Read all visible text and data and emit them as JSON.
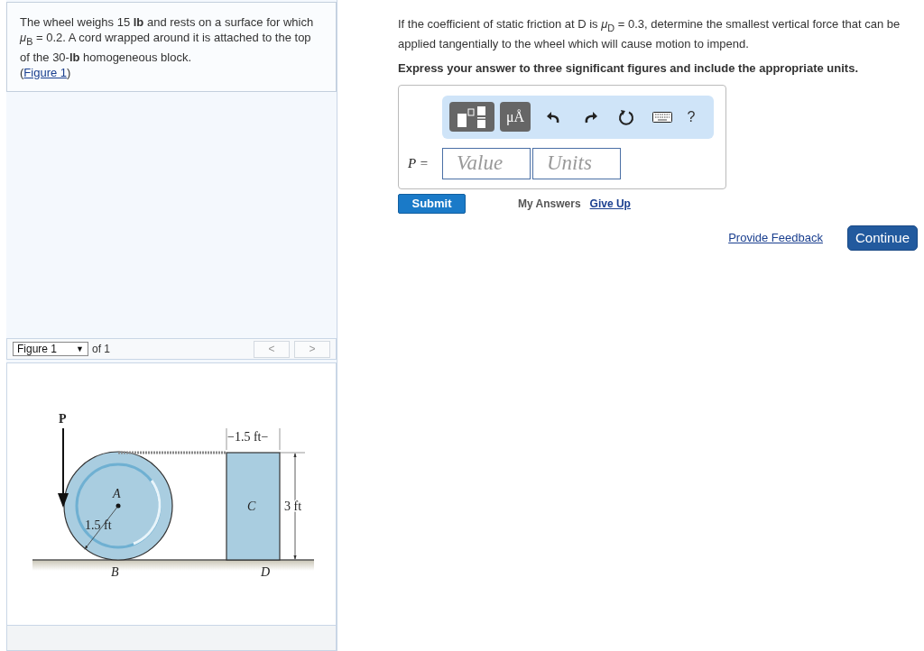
{
  "problem": {
    "text": "The wheel weighs 15 **lb** and rests on a surface for which *μ*$_{B}$ = 0.2. A cord wrapped around it is attached to the top of the 30-**lb** homogeneous block.",
    "figure_link_open": "(",
    "figure_link": "Figure 1",
    "figure_link_close": ")"
  },
  "figure_bar": {
    "select": "Figure 1",
    "select_caret": "▼",
    "of": "of 1",
    "prev": "<",
    "next": ">"
  },
  "figure": {
    "labels": [
      "P",
      "−1.5 ft−",
      "A",
      "1.5 ft",
      "C",
      "3 ft",
      "B",
      "D"
    ]
  },
  "part": {
    "question": "If the coefficient of static friction at D is *μ*$_{D}$ = 0.3, determine the smallest vertical force that can be applied tangentially to the wheel which will cause motion to impend.",
    "instruction": "Express your answer to three significant figures and include the appropriate units.",
    "toolbar": {
      "units_button": "μÅ",
      "help": "?"
    },
    "variable": "P =",
    "value_placeholder": "Value",
    "units_placeholder": "Units",
    "submit": "Submit",
    "my_answers": "My Answers",
    "give_up": "Give Up"
  },
  "footer": {
    "feedback": "Provide Feedback",
    "continue": "Continue"
  }
}
